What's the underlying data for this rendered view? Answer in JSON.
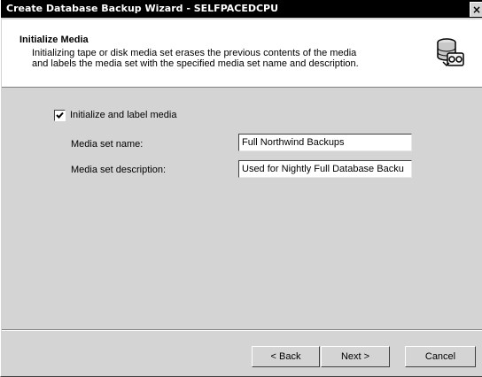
{
  "window": {
    "title": "Create Database Backup Wizard - SELFPACEDCPU",
    "close_label": "×"
  },
  "header": {
    "title": "Initialize Media",
    "description": "Initializing tape or disk media set erases the previous contents of the media and labels the media set with the specified media set name and description.",
    "icon": "tape-backup-icon"
  },
  "form": {
    "initialize_checkbox": {
      "label": "Initialize and label media",
      "checked": true
    },
    "media_set_name": {
      "label": "Media set name:",
      "value": "Full Northwind Backups"
    },
    "media_set_description": {
      "label": "Media set description:",
      "value": "Used for Nightly Full Database Backu"
    }
  },
  "buttons": {
    "back": "< Back",
    "next": "Next >",
    "cancel": "Cancel"
  }
}
